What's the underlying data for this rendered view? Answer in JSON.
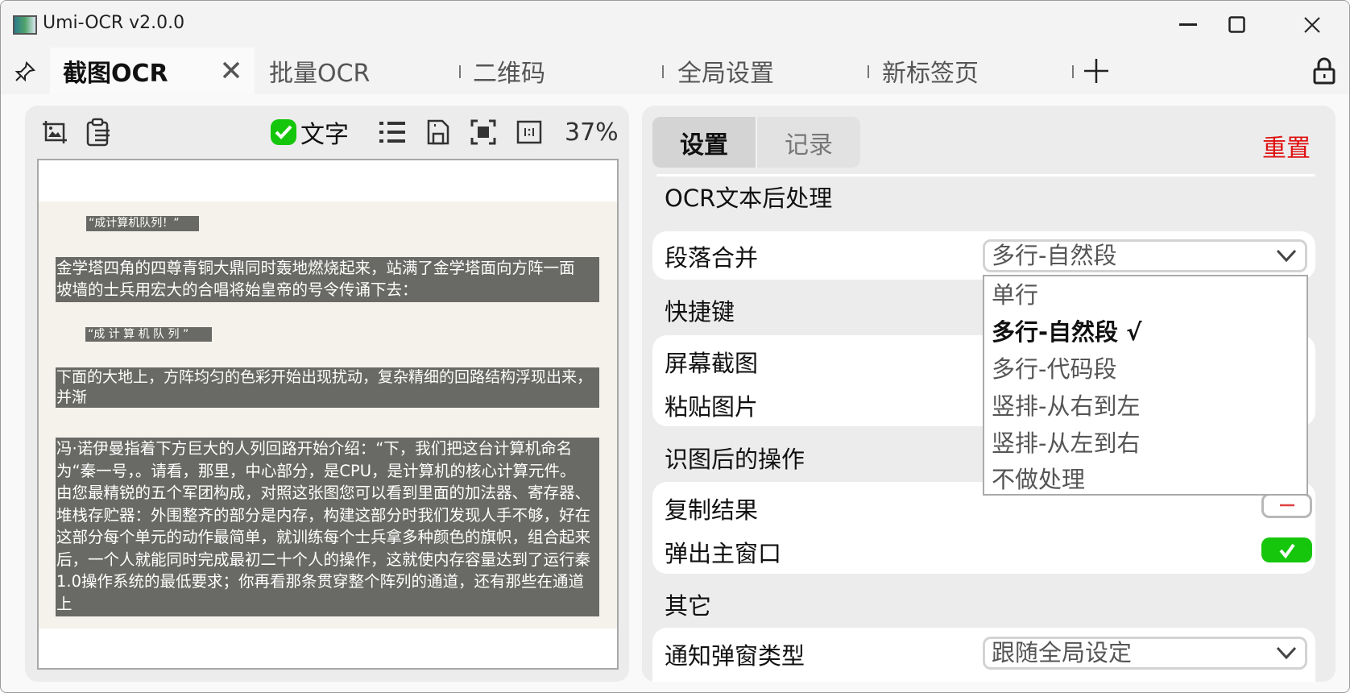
{
  "window": {
    "title": "Umi-OCR v2.0.0"
  },
  "tabs": [
    {
      "label": "截图OCR",
      "active": true
    },
    {
      "label": "批量OCR"
    },
    {
      "label": "二维码"
    },
    {
      "label": "全局设置"
    },
    {
      "label": "新标签页"
    }
  ],
  "toolbar": {
    "text_toggle_label": "文字",
    "text_toggle_checked": true,
    "zoom": "37%"
  },
  "image": {
    "blocks": [
      "“成计算机队列！”",
      "金学塔四角的四尊青铜大鼎同时轰地燃烧起来，站满了金学塔面向方阵一面\n坡墙的士兵用宏大的合唱将始皇帝的号令传诵下去：",
      "“成 计 算 机 队 列 ”",
      "下面的大地上，方阵均匀的色彩开始出现扰动，复杂精细的回路结构浮现出来，并渐\n渐充满了整个方阵库，十分钟后，大地上出现了一块三十六平方公里的计算机主板。",
      "冯·诺伊曼指着下方巨大的人列回路开始介绍：“下，我们把这台计算机命名\n为“秦一号，。请看，那里，中心部分，是CPU，是计算机的核心计算元件。\n由您最精锐的五个军团构成，对照这张图您可以看到里面的加法器、寄存器、\n堆栈存贮器：外围整齐的部分是内存，构建这部分时我们发现人手不够，好在\n这部分每个单元的动作最简单，就训练每个士兵拿多种颜色的旗帜，组合起来\n后，一个人就能同时完成最初二十个人的操作，这就使内存容量达到了运行秦\n1.0操作系统的最低要求；你再看那条贯穿整个阵列的通道，还有那些在通道上\n待命的轻转兵，那是BUS，系统总线，负责在整个系统间传递信息。”"
    ]
  },
  "settings": {
    "tabs": [
      "设置",
      "记录"
    ],
    "active_tab": "设置",
    "reset_label": "重置",
    "reset_color": "#e01010",
    "sections": [
      {
        "heading": "OCR文本后处理",
        "items": [
          {
            "label": "段落合并",
            "value": "多行-自然段"
          }
        ]
      },
      {
        "heading": "快捷键",
        "items": [
          {
            "label": "屏幕截图"
          },
          {
            "label": "粘贴图片"
          }
        ]
      },
      {
        "heading": "识图后的操作",
        "items": [
          {
            "label": "复制结果",
            "checked": false
          },
          {
            "label": "弹出主窗口",
            "checked": true
          }
        ]
      },
      {
        "heading": "其它",
        "items": [
          {
            "label": "通知弹窗类型",
            "value": "跟随全局设定"
          }
        ]
      }
    ],
    "dropdown_options": [
      "单行",
      "多行-自然段 √",
      "多行-代码段",
      "竖排-从右到左",
      "竖排-从左到右",
      "不做处理"
    ],
    "dropdown_selected_index": 1,
    "accent_green": "#16c60c"
  }
}
